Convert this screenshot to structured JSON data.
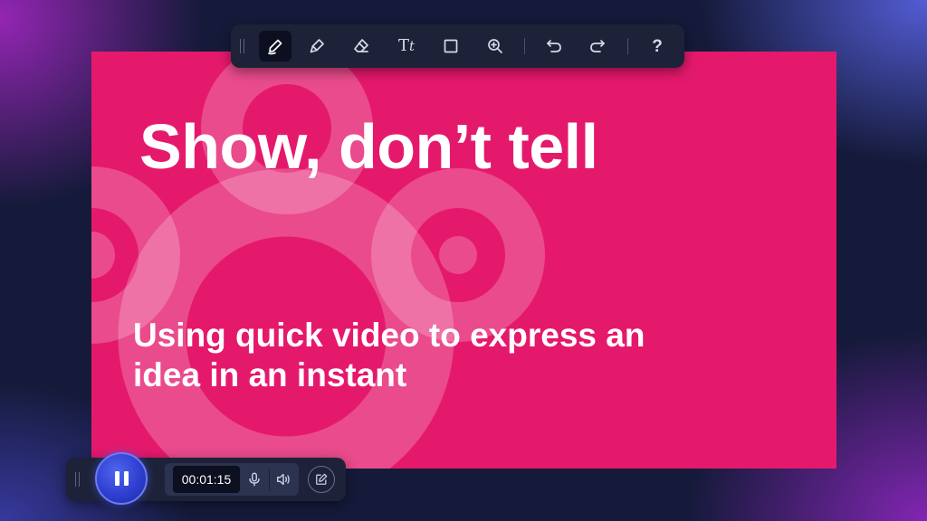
{
  "colors": {
    "slide_background": "#e5196c",
    "toolbar_background": "#1d2238",
    "record_accent": "#3a4ce0",
    "text": "#ffffff"
  },
  "slide": {
    "title": "Show, don’t tell",
    "subtitle": "Using quick video to express an idea in an instant"
  },
  "toolbar": {
    "tools": [
      {
        "name": "pen",
        "icon": "pen-icon",
        "active": true
      },
      {
        "name": "highlighter",
        "icon": "highlighter-icon",
        "active": false
      },
      {
        "name": "eraser",
        "icon": "eraser-icon",
        "active": false
      },
      {
        "name": "text",
        "icon": "text-tool-icon",
        "label": "Tt",
        "active": false
      },
      {
        "name": "rectangle",
        "icon": "rectangle-icon",
        "active": false
      },
      {
        "name": "zoom",
        "icon": "zoom-in-icon",
        "active": false
      },
      {
        "name": "undo",
        "icon": "undo-icon",
        "active": false
      },
      {
        "name": "redo",
        "icon": "redo-icon",
        "active": false
      },
      {
        "name": "help",
        "icon": "help-icon",
        "label": "?",
        "active": false
      }
    ]
  },
  "recorder": {
    "state": "recording",
    "pause_icon": "pause-icon",
    "timer": "00:01:15",
    "mic_icon": "microphone-icon",
    "speaker_icon": "speaker-icon",
    "annotate_icon": "annotate-icon"
  }
}
